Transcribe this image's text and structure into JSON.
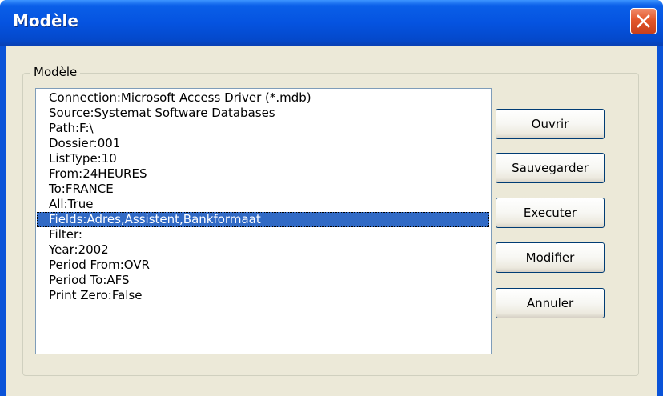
{
  "window": {
    "title": "Modèle"
  },
  "group": {
    "legend": "Modèle"
  },
  "list": {
    "items": [
      "Connection:Microsoft Access Driver (*.mdb)",
      "Source:Systemat Software Databases",
      "Path:F:\\",
      "Dossier:001",
      "ListType:10",
      "From:24HEURES",
      "To:FRANCE",
      "All:True",
      "Fields:Adres,Assistent,Bankformaat",
      "Filter:",
      "Year:2002",
      "Period From:OVR",
      "Period To:AFS",
      "Print Zero:False"
    ],
    "selected_index": 8
  },
  "buttons": {
    "open": "Ouvrir",
    "save": "Sauvegarder",
    "execute": "Executer",
    "modify": "Modifier",
    "cancel": "Annuler"
  },
  "colors": {
    "titlebar": "#0553e0",
    "selection": "#316ac5",
    "dialog_bg": "#ece9d8"
  }
}
